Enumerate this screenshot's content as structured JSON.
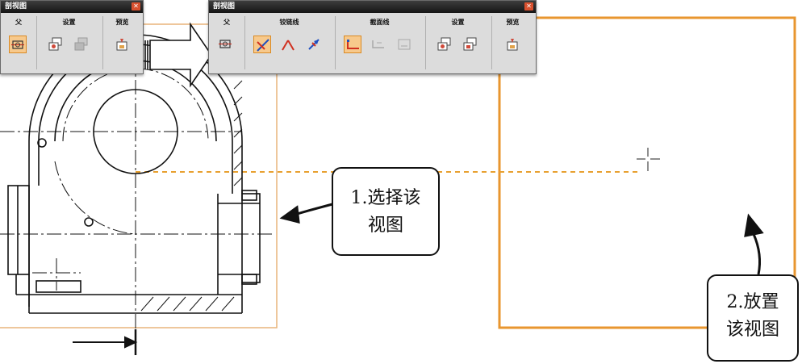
{
  "toolbar_left": {
    "title": "剖视图",
    "close": "✕",
    "groups": [
      {
        "label": "父"
      },
      {
        "label": "设置"
      },
      {
        "label": "预览"
      }
    ]
  },
  "toolbar_right": {
    "title": "剖视图",
    "close": "✕",
    "groups": [
      {
        "label": "父"
      },
      {
        "label": "铰链线"
      },
      {
        "label": "截面线"
      },
      {
        "label": "设置"
      },
      {
        "label": "预览"
      }
    ]
  },
  "callouts": {
    "select": {
      "line1": "1.选择该",
      "line2": "视图"
    },
    "place": {
      "line1": "2.放置",
      "line2": "该视图"
    }
  },
  "colors": {
    "view_border": "#e8a050",
    "placement_border": "#e89030",
    "hinge_line": "#e8a030",
    "active_button": "#f7c98c"
  }
}
